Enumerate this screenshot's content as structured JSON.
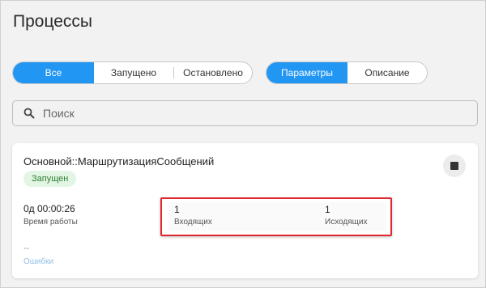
{
  "page": {
    "title": "Процессы"
  },
  "filter": {
    "options": [
      {
        "label": "Все",
        "active": true
      },
      {
        "label": "Запущено",
        "active": false
      },
      {
        "label": "Остановлено",
        "active": false
      }
    ]
  },
  "view": {
    "options": [
      {
        "label": "Параметры",
        "active": true
      },
      {
        "label": "Описание",
        "active": false
      }
    ]
  },
  "search": {
    "placeholder": "Поиск",
    "value": "",
    "icon": "search-icon"
  },
  "process": {
    "name": "Основной::МаршрутизацияСообщений",
    "status": "Запущен",
    "stop_icon": "stop-icon",
    "uptime": {
      "value": "0д 00:00:26",
      "label": "Время работы"
    },
    "incoming": {
      "value": "1",
      "label": "Входящих"
    },
    "outgoing": {
      "value": "1",
      "label": "Исходящих"
    },
    "errors": {
      "value": "--",
      "label": "Ошибки"
    }
  },
  "colors": {
    "accent": "#2196f3",
    "status_bg": "#e3f6e5",
    "status_text": "#2e7d32",
    "highlight": "#e0262e",
    "link": "#8fbfe8"
  }
}
